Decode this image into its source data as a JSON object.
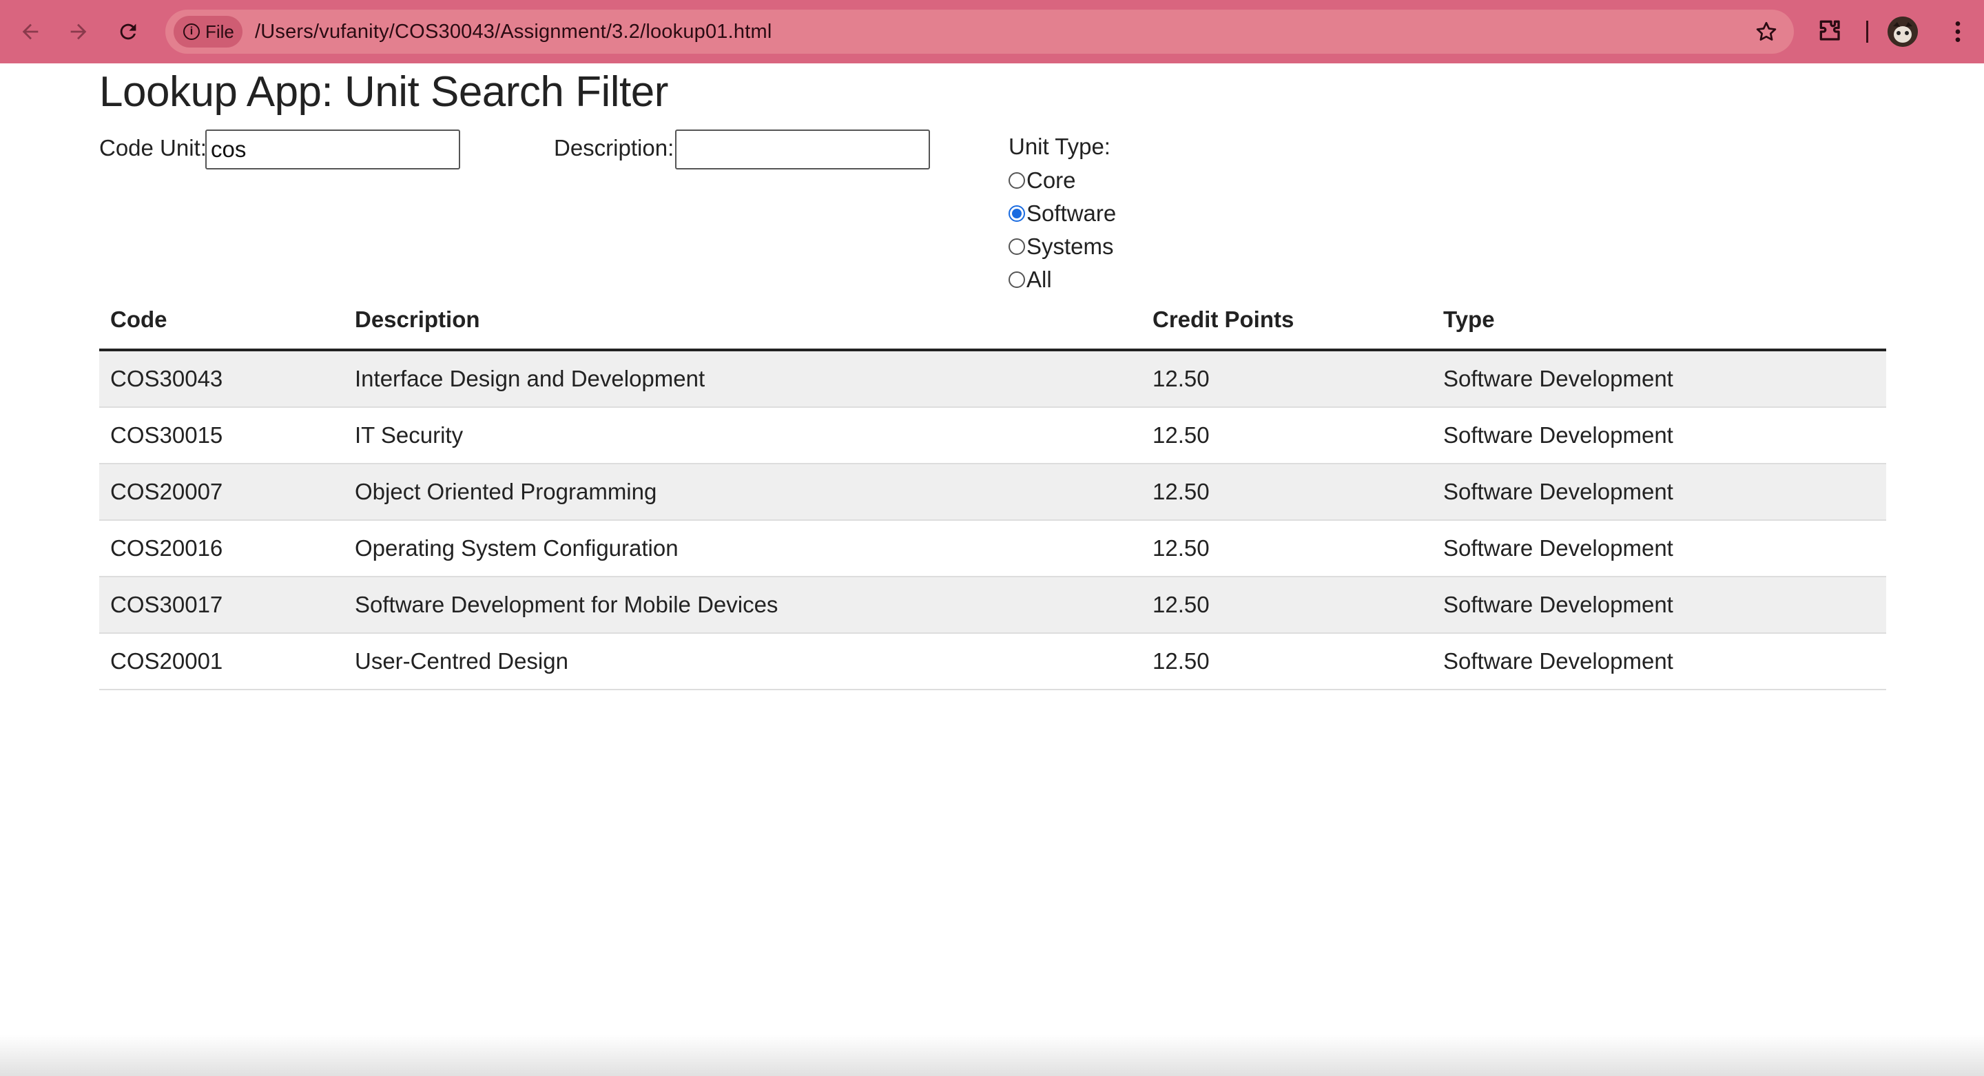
{
  "browser": {
    "site_chip_label": "File",
    "url": "/Users/vufanity/COS30043/Assignment/3.2/lookup01.html",
    "toolbar_color": "#d9657f"
  },
  "page": {
    "title": "Lookup App: Unit Search Filter",
    "code_unit_label": "Code Unit:",
    "code_unit_value": "cos",
    "description_label": "Description:",
    "description_value": "",
    "unit_type_label": "Unit Type:",
    "unit_type_options": [
      "Core",
      "Software",
      "Systems",
      "All"
    ],
    "unit_type_selected": "Software"
  },
  "table": {
    "headers": [
      "Code",
      "Description",
      "Credit Points",
      "Type"
    ],
    "rows": [
      [
        "COS30043",
        "Interface Design and Development",
        "12.50",
        "Software Development"
      ],
      [
        "COS30015",
        "IT Security",
        "12.50",
        "Software Development"
      ],
      [
        "COS20007",
        "Object Oriented Programming",
        "12.50",
        "Software Development"
      ],
      [
        "COS20016",
        "Operating System Configuration",
        "12.50",
        "Software Development"
      ],
      [
        "COS30017",
        "Software Development for Mobile Devices",
        "12.50",
        "Software Development"
      ],
      [
        "COS20001",
        "User-Centred Design",
        "12.50",
        "Software Development"
      ]
    ]
  },
  "icons": [
    "back-arrow-icon",
    "forward-arrow-icon",
    "reload-icon",
    "info-icon",
    "star-icon",
    "extensions-icon",
    "avatar",
    "kebab-menu-icon"
  ]
}
